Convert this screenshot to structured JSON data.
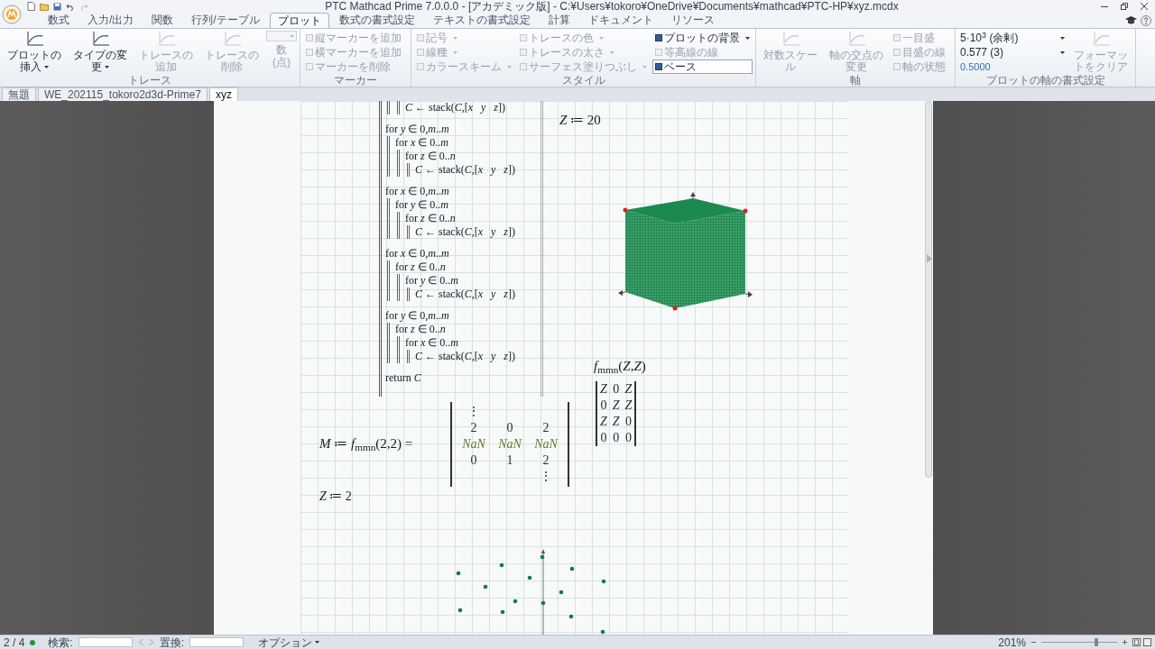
{
  "window": {
    "title": "PTC Mathcad Prime 7.0.0.0 - [アカデミック版] - C:¥Users¥tokoro¥OneDrive¥Documents¥mathcad¥PTC-HP¥xyz.mcdx"
  },
  "ribbon_tabs": [
    {
      "label": "数式",
      "selected": false
    },
    {
      "label": "入力/出力",
      "selected": false
    },
    {
      "label": "関数",
      "selected": false
    },
    {
      "label": "行列/テーブル",
      "selected": false
    },
    {
      "label": "プロット",
      "selected": true
    },
    {
      "label": "数式の書式設定",
      "selected": false
    },
    {
      "label": "テキストの書式設定",
      "selected": false
    },
    {
      "label": "計算",
      "selected": false
    },
    {
      "label": "ドキュメント",
      "selected": false
    },
    {
      "label": "リソース",
      "selected": false
    }
  ],
  "ribbon": {
    "groups": [
      {
        "label": "トレース",
        "columns": [
          [
            {
              "kind": "large",
              "label": "プロットの挿入",
              "dropdown": true,
              "disabled": false
            }
          ],
          [
            {
              "kind": "large",
              "label": "タイプの変更",
              "dropdown": true,
              "disabled": false
            }
          ],
          [
            {
              "kind": "large",
              "label": "トレースの追加",
              "dropdown": false,
              "disabled": true
            }
          ],
          [
            {
              "kind": "large",
              "label": "トレースの削除",
              "dropdown": false,
              "disabled": true
            }
          ],
          [
            {
              "kind": "combo",
              "label": "数",
              "sublabel": "(点)",
              "dropdown": true,
              "disabled": true
            }
          ]
        ]
      },
      {
        "label": "マーカー",
        "columns": [
          [
            {
              "kind": "small",
              "label": "縦マーカーを追加",
              "dropdown": false,
              "disabled": true
            },
            {
              "kind": "small",
              "label": "横マーカーを追加",
              "dropdown": false,
              "disabled": true
            },
            {
              "kind": "small",
              "label": "マーカーを削除",
              "dropdown": false,
              "disabled": true
            }
          ]
        ]
      },
      {
        "label": "スタイル",
        "columns": [
          [
            {
              "kind": "small",
              "label": "記号",
              "dropdown": true,
              "disabled": true
            },
            {
              "kind": "small",
              "label": "線種",
              "dropdown": true,
              "disabled": true
            },
            {
              "kind": "small",
              "label": "カラースキーム",
              "dropdown": true,
              "disabled": true
            }
          ],
          [
            {
              "kind": "small",
              "label": "トレースの色",
              "dropdown": true,
              "disabled": true
            },
            {
              "kind": "small",
              "label": "トレースの太さ",
              "dropdown": true,
              "disabled": true
            },
            {
              "kind": "small",
              "label": "サーフェス塗りつぶし",
              "dropdown": true,
              "disabled": true
            }
          ],
          [
            {
              "kind": "small",
              "label": "プロットの背景",
              "dropdown": true,
              "disabled": false,
              "on": false
            },
            {
              "kind": "small",
              "label": "等高線の線",
              "dropdown": false,
              "disabled": true,
              "on": false
            },
            {
              "kind": "small",
              "label": "ベース",
              "dropdown": false,
              "disabled": false,
              "on": true
            }
          ]
        ]
      },
      {
        "label": "軸",
        "columns": [
          [
            {
              "kind": "large",
              "label": "対数スケール",
              "dropdown": false,
              "disabled": true
            }
          ],
          [
            {
              "kind": "large",
              "label": "軸の交点の変更",
              "dropdown": false,
              "disabled": true
            }
          ],
          [
            {
              "kind": "small",
              "label": "一目盛",
              "dropdown": false,
              "disabled": true
            },
            {
              "kind": "small",
              "label": "目盛の線",
              "dropdown": false,
              "disabled": true
            },
            {
              "kind": "small",
              "label": "軸の状態",
              "dropdown": false,
              "disabled": true
            }
          ]
        ]
      },
      {
        "label": "プロットの軸の書式設定",
        "columns": [
          [
            {
              "kind": "select",
              "label": "5·10$^{3}$ (余剰)",
              "dropdown": true,
              "disabled": false
            },
            {
              "kind": "select",
              "label": "0.577 (3)",
              "dropdown": true,
              "disabled": false
            },
            {
              "kind": "value",
              "label": "0.5000",
              "dropdown": false,
              "disabled": false
            }
          ],
          [
            {
              "kind": "large",
              "label": "フォーマットをクリア",
              "dropdown": false,
              "disabled": true
            }
          ]
        ]
      }
    ]
  },
  "document_tabs": [
    {
      "label": "無題",
      "selected": false
    },
    {
      "label": "WE_202115_tokoro2d3d-Prime7",
      "selected": false
    },
    {
      "label": "xyz",
      "selected": true
    }
  ],
  "worksheet": {
    "program": {
      "lines": [
        {
          "children": [
            {
              "children": [
                {
                  "text": "*C* ← stack(*C*,[*x*   *y*   *z*])"
                }
              ]
            }
          ]
        },
        {
          "text": "for *y* ∈ 0,*m*..*m*",
          "children": [
            {
              "text": "for *x* ∈ 0..*m*",
              "children": [
                {
                  "text": "for *z* ∈ 0..*n*",
                  "children": [
                    {
                      "text": "*C* ← stack(*C*,[*x*   *y*   *z*])"
                    }
                  ]
                }
              ]
            }
          ]
        },
        {
          "text": "for *x* ∈ 0,*m*..*m*",
          "children": [
            {
              "text": "for *y* ∈ 0..*m*",
              "children": [
                {
                  "text": "for *z* ∈ 0..*n*",
                  "children": [
                    {
                      "text": "*C* ← stack(*C*,[*x*   *y*   *z*])"
                    }
                  ]
                }
              ]
            }
          ]
        },
        {
          "text": "for *x* ∈ 0,*m*..*m*",
          "children": [
            {
              "text": "for *z* ∈ 0..*n*",
              "children": [
                {
                  "text": "for *y* ∈ 0..*m*",
                  "children": [
                    {
                      "text": "*C* ← stack(*C*,[*x*   *y*   *z*])"
                    }
                  ]
                }
              ]
            }
          ]
        },
        {
          "text": "for *y* ∈ 0,*m*..*m*",
          "children": [
            {
              "text": "for *z* ∈ 0..*n*",
              "children": [
                {
                  "text": "for *x* ∈ 0..*m*",
                  "children": [
                    {
                      "text": "*C* ← stack(*C*,[*x*   *y*   *z*])"
                    }
                  ]
                }
              ]
            }
          ]
        },
        {
          "text": "return *C*"
        }
      ]
    },
    "z_definition_top": "*Z* ≔ 20",
    "f_evaluation": {
      "expression": "*f*$_{mmn}$(*Z*,*Z*)",
      "matrix": [
        [
          "*Z*",
          "0",
          "*Z*"
        ],
        [
          "0",
          "*Z*",
          "*Z*"
        ],
        [
          "*Z*",
          "*Z*",
          "0"
        ],
        [
          "0",
          "0",
          "0"
        ]
      ]
    },
    "m_definition": {
      "expression": "*M* ≔ *f*$_{mmn}$(2,2) =",
      "rows": [
        {
          "kind": "leading",
          "text": "⋮"
        },
        {
          "kind": "values",
          "cells": [
            "2",
            "0",
            "2"
          ]
        },
        {
          "kind": "nan",
          "cells": [
            "NaN",
            "NaN",
            "NaN"
          ]
        },
        {
          "kind": "values",
          "cells": [
            "0",
            "1",
            "2"
          ]
        },
        {
          "kind": "trailing",
          "text": "⋮"
        }
      ]
    },
    "z_definition_bottom": "*Z* ≔ 2"
  },
  "status_bar": {
    "page": "2 / 4",
    "search_label": "検索:",
    "replace_label": "置換:",
    "options": "オプション",
    "zoom": "201%",
    "zoom_slider": {
      "level": 0.7
    }
  }
}
